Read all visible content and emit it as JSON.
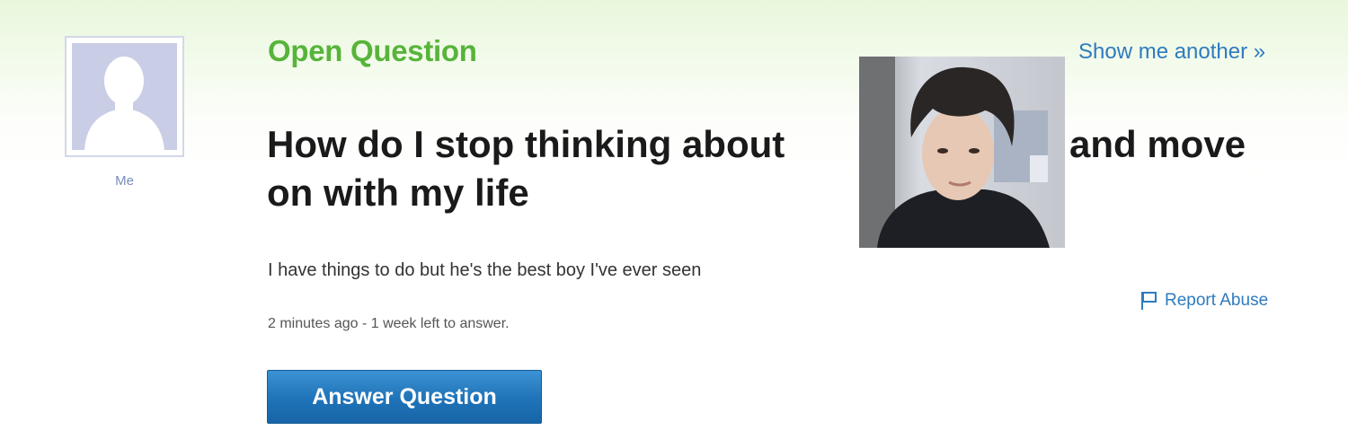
{
  "profile": {
    "avatar_icon": "default-avatar-silhouette-icon",
    "label": "Me"
  },
  "question": {
    "status_label": "Open Question",
    "title_main": "How do I stop thinking about",
    "title_line2": "on with my life",
    "title_tail": "and move",
    "body": "I have things to do but he's the best boy I've ever seen",
    "meta": "2 minutes ago - 1 week left to answer."
  },
  "actions": {
    "show_another": "Show me another »",
    "report_abuse": "Report Abuse",
    "report_icon": "flag-icon",
    "answer_button": "Answer Question"
  },
  "colors": {
    "status_green": "#57b43a",
    "link_blue": "#2e7bbf",
    "button_blue": "#1f73b8"
  }
}
